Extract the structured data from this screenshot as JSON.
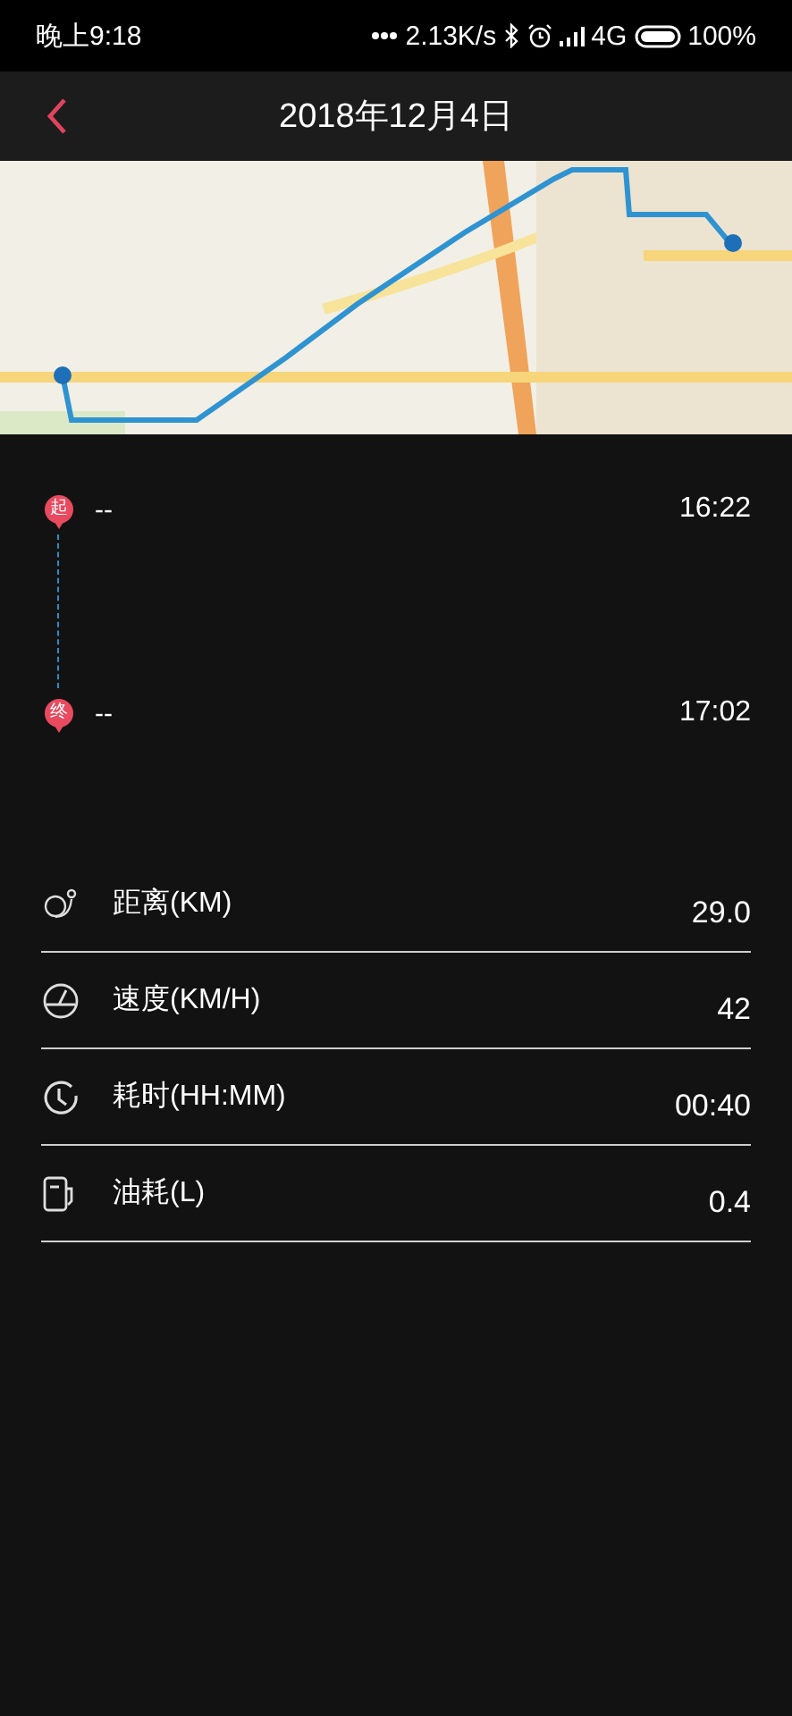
{
  "status_bar": {
    "time": "晚上9:18",
    "speed": "2.13K/s",
    "network": "4G",
    "battery": "100%"
  },
  "header": {
    "title": "2018年12月4日"
  },
  "trip_points": [
    {
      "marker": "起",
      "place": "--",
      "time": "16:22"
    },
    {
      "marker": "终",
      "place": "--",
      "time": "17:02"
    }
  ],
  "stats": [
    {
      "kind": "distance",
      "label": "距离(KM)",
      "value": "29.0"
    },
    {
      "kind": "speed",
      "label": "速度(KM/H)",
      "value": "42"
    },
    {
      "kind": "duration",
      "label": "耗时(HH:MM)",
      "value": "00:40"
    },
    {
      "kind": "fuel",
      "label": "油耗(L)",
      "value": "0.4"
    }
  ]
}
